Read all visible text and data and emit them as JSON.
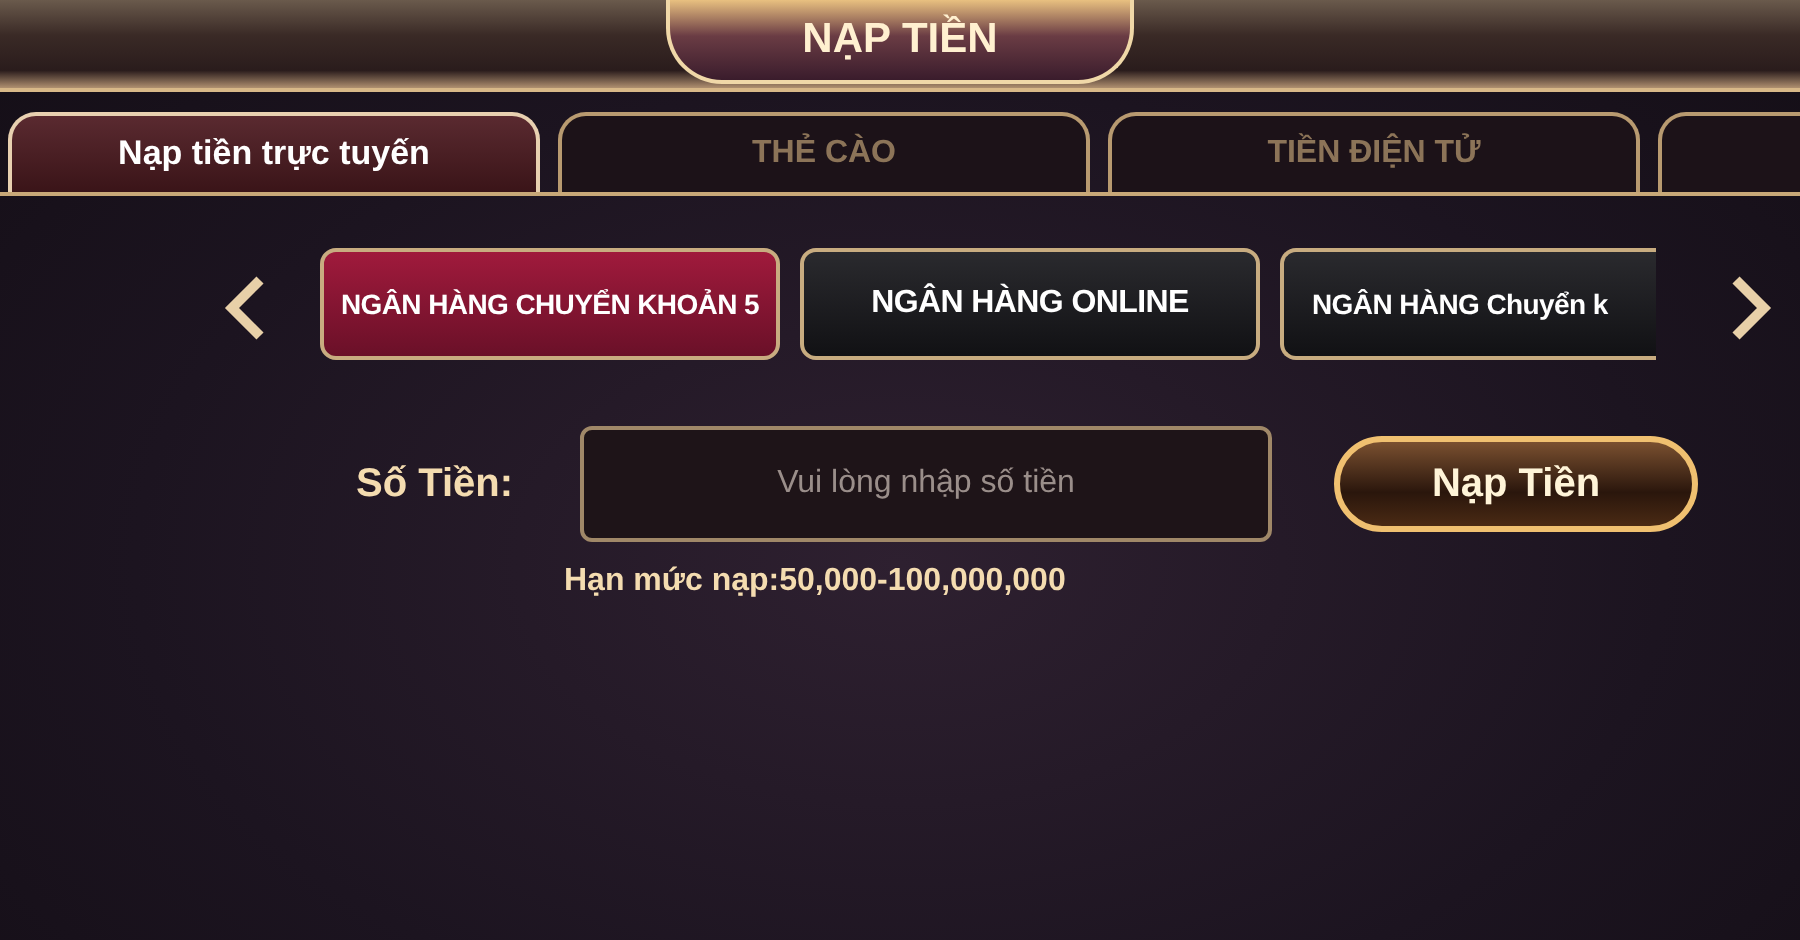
{
  "header": {
    "title": "NẠP TIỀN"
  },
  "tabs": [
    {
      "label": "Nạp tiền trực tuyến",
      "selected": true
    },
    {
      "label": "THẺ CÀO",
      "selected": false
    },
    {
      "label": "TIỀN ĐIỆN TỬ",
      "selected": false
    }
  ],
  "banks": [
    {
      "label": "NGÂN HÀNG CHUYỂN KHOẢN 5",
      "selected": true
    },
    {
      "label": "NGÂN HÀNG ONLINE",
      "selected": false
    },
    {
      "label": "NGÂN HÀNG Chuyển k",
      "selected": false
    }
  ],
  "amount": {
    "label": "Số Tiền:",
    "placeholder": "Vui lòng nhập số tiền",
    "button": "Nạp Tiền"
  },
  "limit": "Hạn mức nạp:50,000-100,000,000"
}
